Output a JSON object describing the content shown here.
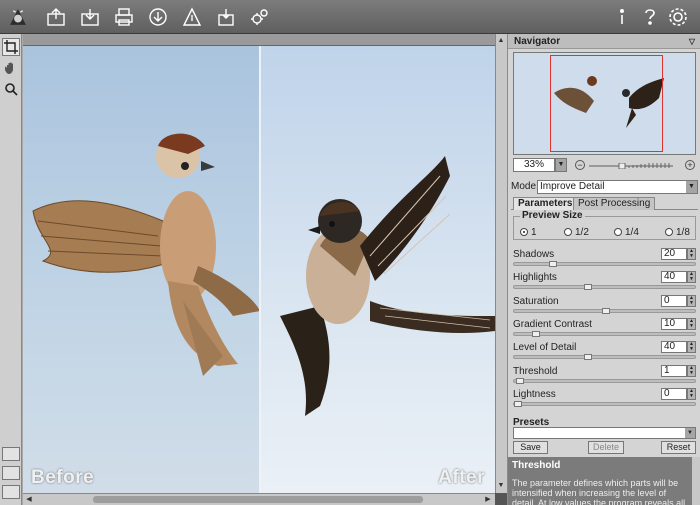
{
  "toolbar": {
    "left_icons": [
      "app-logo-icon",
      "open-image-icon",
      "save-image-icon",
      "print-icon",
      "export-icon",
      "share-icon",
      "batch-icon",
      "settings-gears-icon"
    ],
    "right_icons": [
      "info-icon",
      "help-icon",
      "preferences-icon"
    ]
  },
  "tools": [
    "crop-icon",
    "hand-icon",
    "zoom-icon"
  ],
  "canvas": {
    "before_label": "Before",
    "after_label": "After"
  },
  "navigator": {
    "title": "Navigator",
    "zoom_value": "33%"
  },
  "mode": {
    "label": "Mode:",
    "value": "Improve Detail"
  },
  "tabs": [
    {
      "label": "Parameters",
      "active": true
    },
    {
      "label": "Post Processing",
      "active": false
    }
  ],
  "preview_size": {
    "title": "Preview Size",
    "options": [
      "1",
      "1/2",
      "1/4",
      "1/8"
    ],
    "selected": "1"
  },
  "params": [
    {
      "label": "Shadows",
      "value": "20",
      "level": 0.2
    },
    {
      "label": "Highlights",
      "value": "40",
      "level": 0.4
    },
    {
      "label": "Saturation",
      "value": "0",
      "level": 0.5
    },
    {
      "label": "Gradient Contrast",
      "value": "10",
      "level": 0.1
    },
    {
      "label": "Level of Detail",
      "value": "40",
      "level": 0.4
    },
    {
      "label": "Threshold",
      "value": "1",
      "level": 0.01
    },
    {
      "label": "Lightness",
      "value": "0",
      "level": 0.0
    }
  ],
  "presets": {
    "title": "Presets",
    "save": "Save",
    "delete": "Delete",
    "reset": "Reset"
  },
  "help": {
    "title": "Threshold",
    "body": "The parameter defines which parts will be intensified when increasing the level of detail. At low values the program reveals all details in"
  },
  "colors": {
    "toolbar": "#6e6e6e",
    "panel": "#d4d4d4",
    "sky_before": "#b8cde2",
    "sky_after": "#dde7f2",
    "nav_frame": "#dd3333"
  }
}
